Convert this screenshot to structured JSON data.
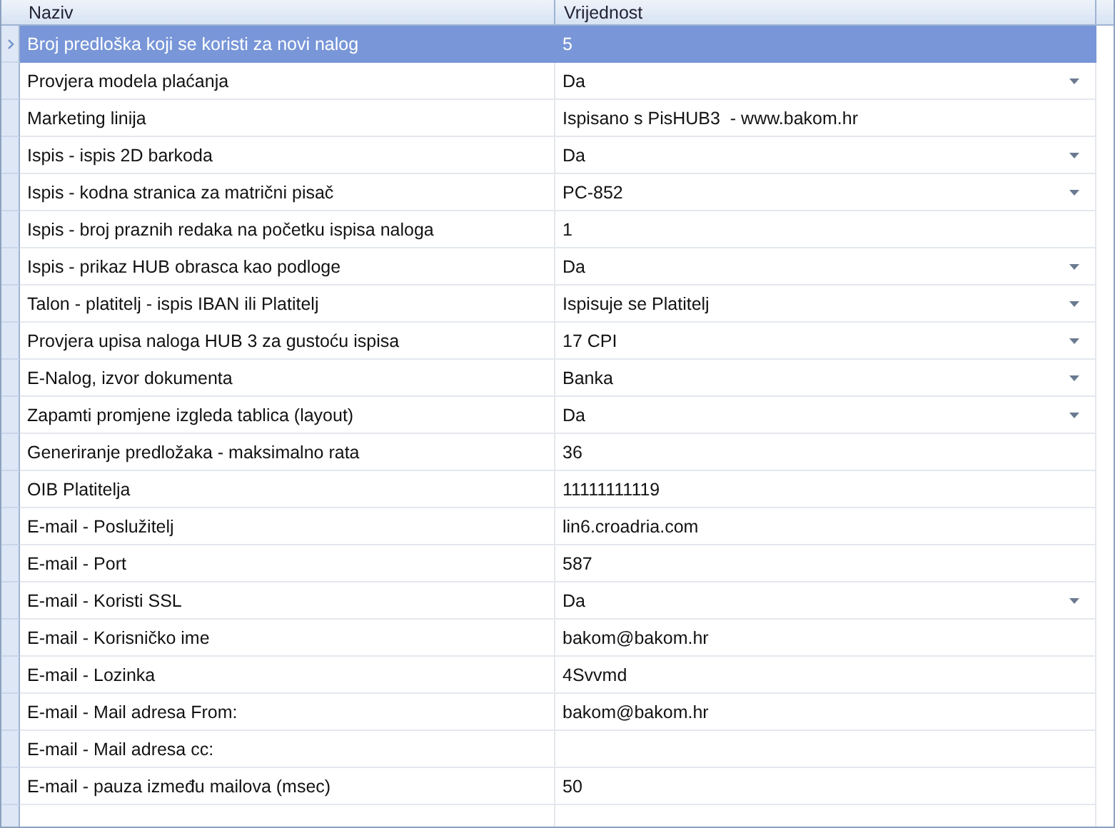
{
  "table": {
    "columns": [
      "Naziv",
      "Vrijednost"
    ],
    "rows": [
      {
        "name": "Broj predloška koji se koristi za novi nalog",
        "value": "5",
        "kind": "text",
        "selected": true
      },
      {
        "name": "Provjera modela plaćanja",
        "value": "Da",
        "kind": "dropdown",
        "selected": false
      },
      {
        "name": "Marketing linija",
        "value": "Ispisano s PisHUB3  - www.bakom.hr",
        "kind": "text",
        "selected": false
      },
      {
        "name": "Ispis - ispis 2D barkoda",
        "value": "Da",
        "kind": "dropdown",
        "selected": false
      },
      {
        "name": "Ispis - kodna stranica za matrični pisač",
        "value": "PC-852",
        "kind": "dropdown",
        "selected": false
      },
      {
        "name": "Ispis - broj praznih redaka na početku ispisa naloga",
        "value": "1",
        "kind": "text",
        "selected": false
      },
      {
        "name": "Ispis - prikaz HUB obrasca kao podloge",
        "value": "Da",
        "kind": "dropdown",
        "selected": false
      },
      {
        "name": "Talon - platitelj - ispis IBAN ili Platitelj",
        "value": "Ispisuje se Platitelj",
        "kind": "dropdown",
        "selected": false
      },
      {
        "name": "Provjera upisa naloga HUB 3 za gustoću ispisa",
        "value": "17 CPI",
        "kind": "dropdown",
        "selected": false
      },
      {
        "name": "E-Nalog, izvor dokumenta",
        "value": "Banka",
        "kind": "dropdown",
        "selected": false
      },
      {
        "name": "Zapamti promjene izgleda tablica (layout)",
        "value": "Da",
        "kind": "dropdown",
        "selected": false
      },
      {
        "name": "Generiranje predložaka - maksimalno rata",
        "value": "36",
        "kind": "text",
        "selected": false
      },
      {
        "name": "OIB Platitelja",
        "value": "11111111119",
        "kind": "text",
        "selected": false
      },
      {
        "name": "E-mail - Poslužitelj",
        "value": "lin6.croadria.com",
        "kind": "text",
        "selected": false
      },
      {
        "name": "E-mail - Port",
        "value": "587",
        "kind": "text",
        "selected": false
      },
      {
        "name": "E-mail - Koristi SSL",
        "value": "Da",
        "kind": "dropdown",
        "selected": false
      },
      {
        "name": "E-mail - Korisničko ime",
        "value": "bakom@bakom.hr",
        "kind": "text",
        "selected": false
      },
      {
        "name": "E-mail - Lozinka",
        "value": "4Svvmd",
        "kind": "text",
        "selected": false
      },
      {
        "name": "E-mail - Mail adresa From:",
        "value": "bakom@bakom.hr",
        "kind": "text",
        "selected": false
      },
      {
        "name": "E-mail - Mail adresa cc:",
        "kind": "text",
        "selected": false
      },
      {
        "name": "E-mail - pauza između mailova (msec)",
        "value": "50",
        "kind": "text",
        "selected": false
      }
    ]
  }
}
